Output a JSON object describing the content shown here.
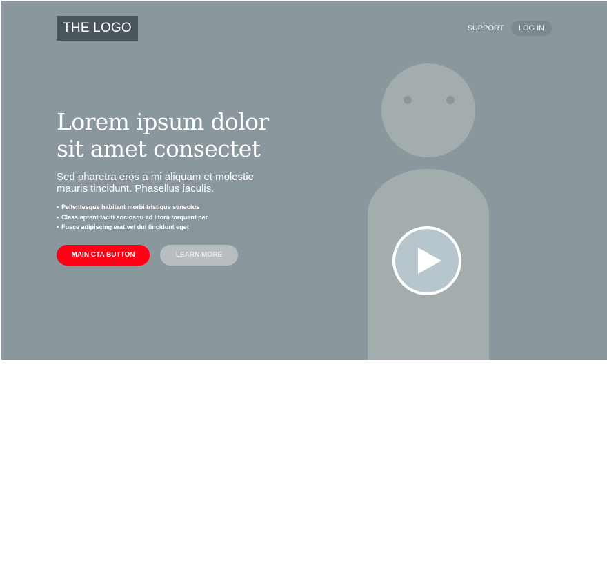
{
  "header": {
    "logo_text": "THE LOGO",
    "nav": {
      "support_label": "SUPPORT",
      "login_label": "LOG IN"
    }
  },
  "hero": {
    "headline_line1": "Lorem ipsum dolor",
    "headline_line2": "sit amet consectet",
    "subhead_line1": "Sed pharetra eros a mi aliquam et molestie",
    "subhead_line2": "mauris tincidunt. Phasellus iaculis.",
    "bullets": [
      "Pellentesque habitant morbi tristique senectus",
      "Class aptent taciti sociosqu ad litora torquent per",
      "Fusce adipiscing erat vel dui tincidunt eget"
    ],
    "primary_button_label": "MAIN CTA BUTTON",
    "secondary_button_label": "LEARN MORE",
    "media_icon": "play-icon"
  },
  "colors": {
    "hero_background": "#8a979c",
    "logo_background": "#4b565c",
    "cta_red": "#ff0016",
    "secondary_button": "#b8bec0",
    "figure_placeholder": "#a3adae"
  }
}
